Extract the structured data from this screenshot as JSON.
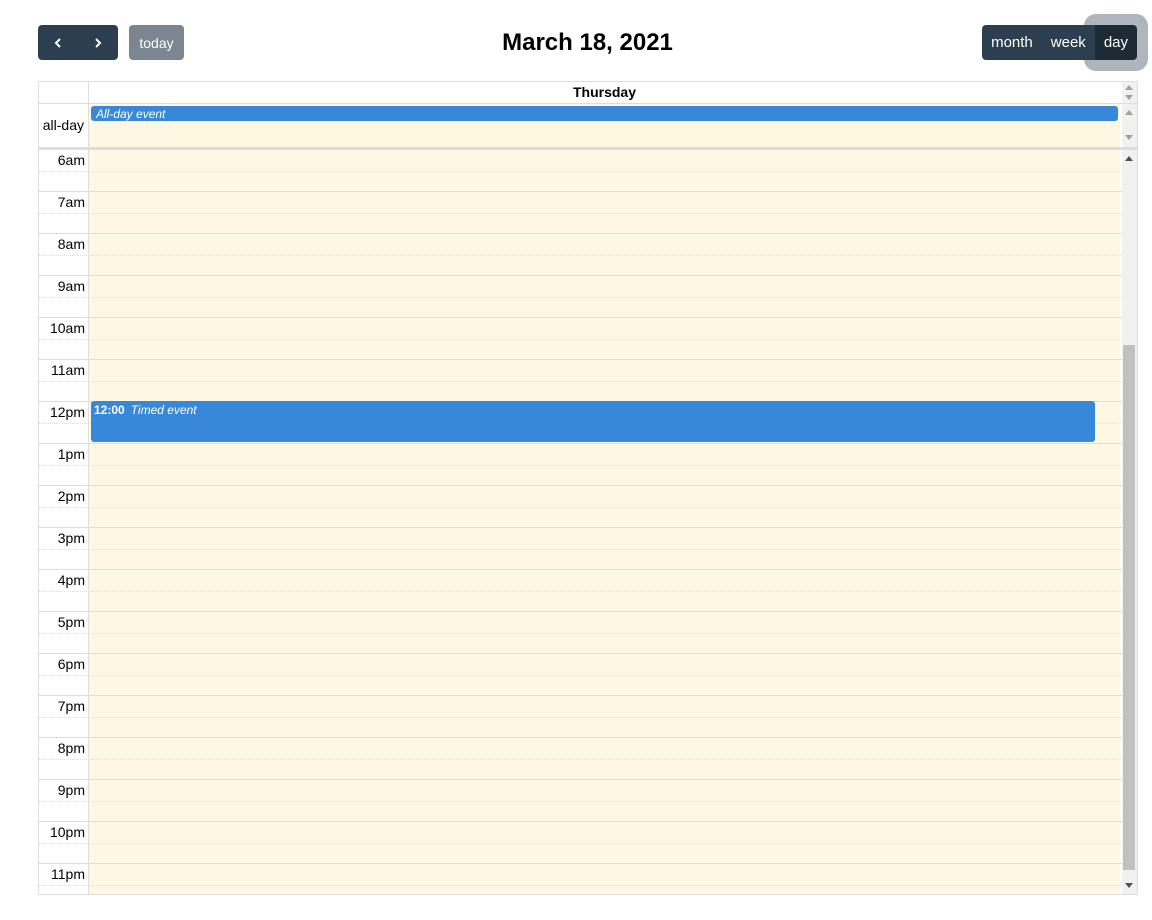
{
  "toolbar": {
    "prev_icon": "chevron-left-icon",
    "next_icon": "chevron-right-icon",
    "today_label": "today",
    "title": "March 18, 2021",
    "views": [
      "month",
      "week",
      "day"
    ],
    "active_view": "day"
  },
  "calendar": {
    "day_header": "Thursday",
    "allday_label": "all-day",
    "allday_event": "All-day event",
    "slots": [
      "6am",
      "7am",
      "8am",
      "9am",
      "10am",
      "11am",
      "12pm",
      "1pm",
      "2pm",
      "3pm",
      "4pm",
      "5pm",
      "6pm",
      "7pm",
      "8pm",
      "9pm",
      "10pm",
      "11pm"
    ],
    "timed_event": {
      "time": "12:00",
      "title": "Timed event"
    }
  },
  "colors": {
    "toolbar_button": "#2c3e50",
    "today_button": "#7b8691",
    "event": "#3788d8",
    "today_bg": "#fef8e3",
    "border": "#dddddd"
  }
}
